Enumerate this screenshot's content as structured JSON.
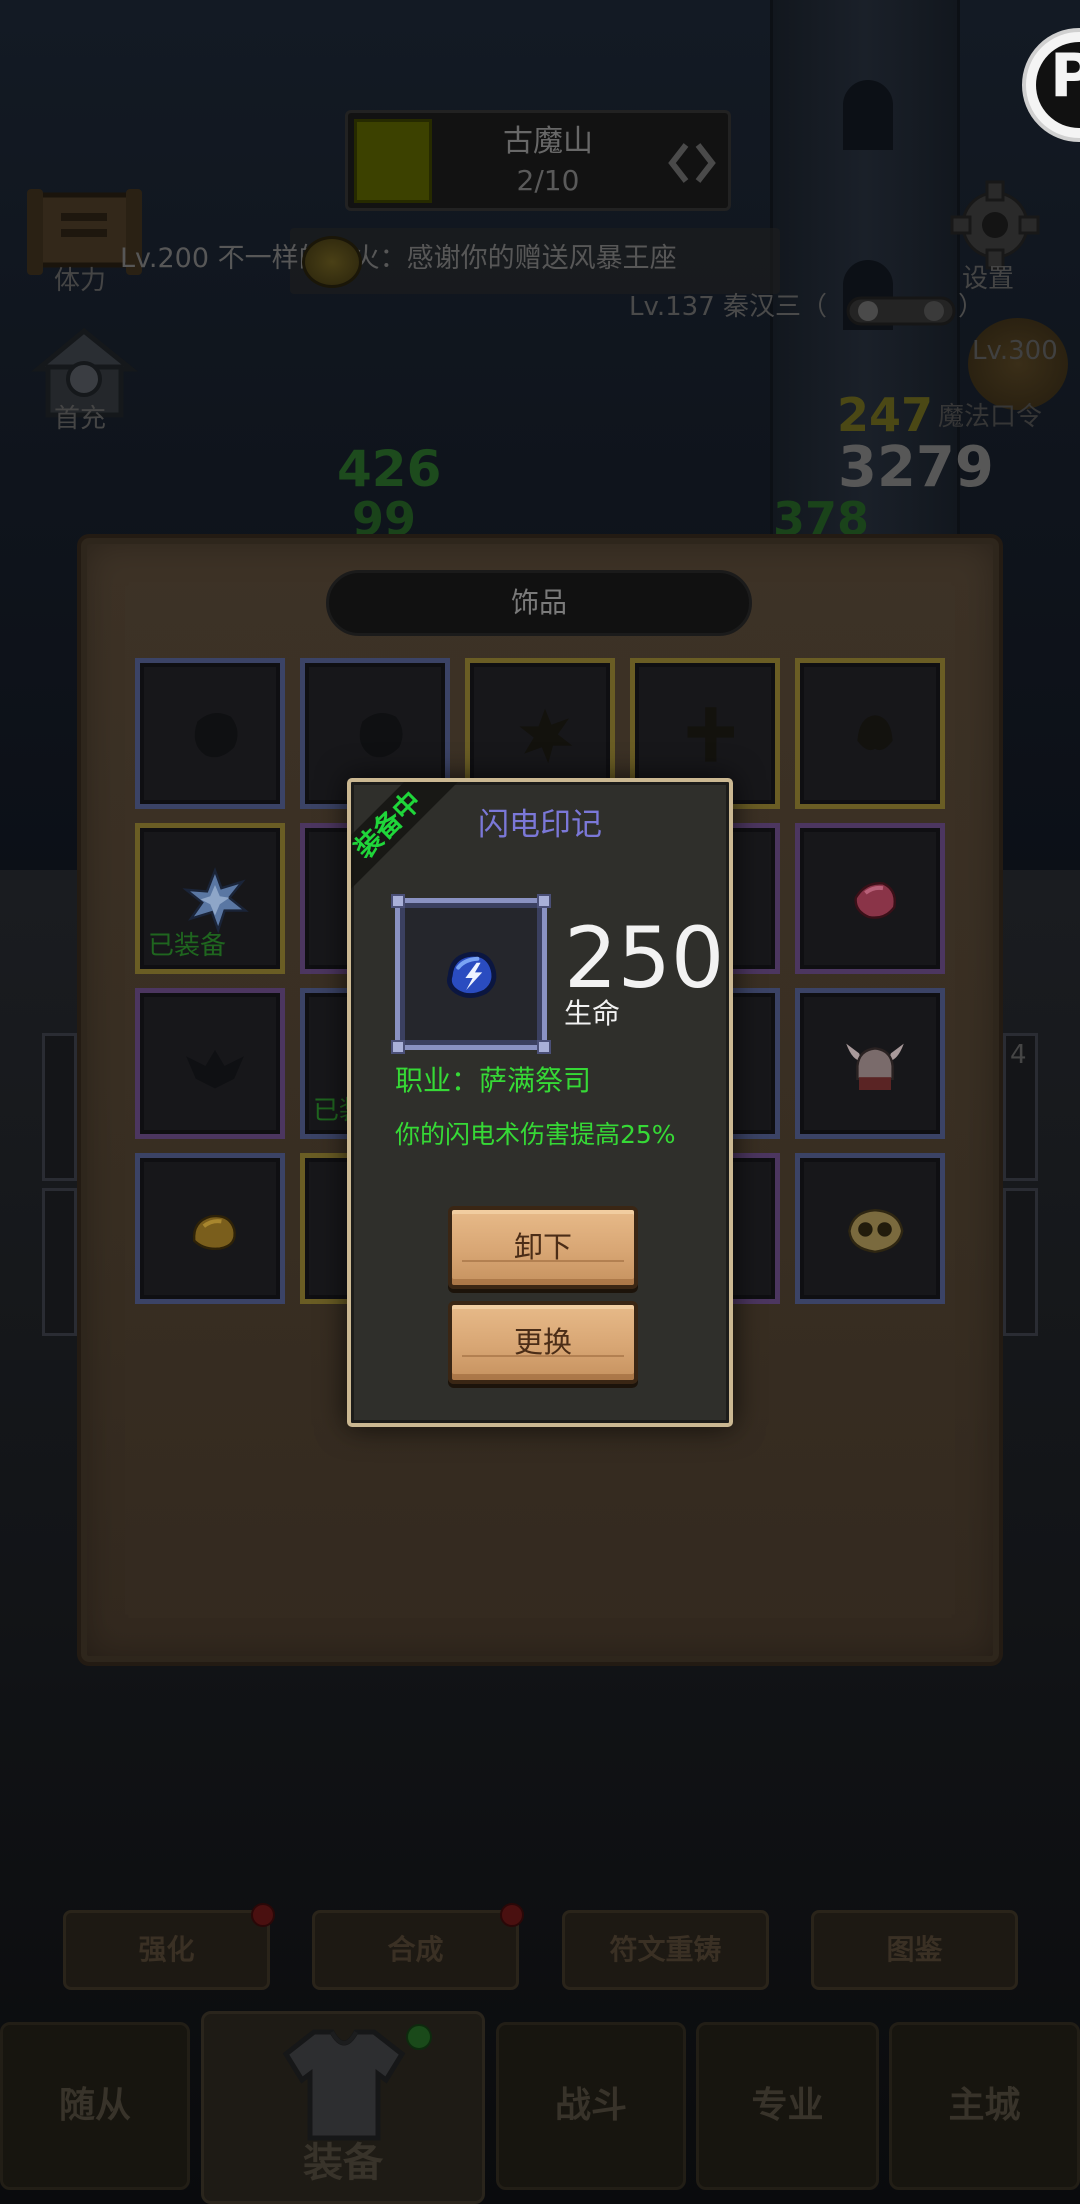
{
  "logo": {
    "letter": "P"
  },
  "stage": {
    "name": "古魔山",
    "progress": "2/10"
  },
  "left_menu": {
    "item1_label": "体力",
    "item2_label": "首充"
  },
  "marquee": {
    "text": "Lv.200 不一样的烟火：感谢你的赠送风暴王座"
  },
  "player": {
    "line": "Lv.137 秦汉三（",
    "close_paren": "）"
  },
  "settings": {
    "label": "设置"
  },
  "enemy": {
    "level": "Lv.300",
    "count": "247",
    "name": "魔法口令",
    "power": "3279"
  },
  "battle_numbers": {
    "value_a": "426",
    "value_b": "99",
    "value_c": "378"
  },
  "side": {
    "count": "4"
  },
  "panel": {
    "title": "饰品",
    "equipped_label": "已装备",
    "rarity_colors": {
      "blue": "#3b4366",
      "gold": "#6a5d24",
      "purple": "#4c3660"
    },
    "slots": [
      {
        "rarity": "blue",
        "icon": "shadow-blob-icon",
        "equipped": false
      },
      {
        "rarity": "blue",
        "icon": "shadow-blob-icon",
        "equipped": false
      },
      {
        "rarity": "gold",
        "icon": "shadow-claw-icon",
        "equipped": false
      },
      {
        "rarity": "gold",
        "icon": "shadow-cross-icon",
        "equipped": false
      },
      {
        "rarity": "gold",
        "icon": "shadow-shell-icon",
        "equipped": false
      },
      {
        "rarity": "gold",
        "icon": "blue-crystal-icon",
        "equipped": true
      },
      {
        "rarity": "purple",
        "icon": null,
        "equipped": false
      },
      {
        "rarity": "blue",
        "icon": null,
        "equipped": false
      },
      {
        "rarity": "purple",
        "icon": null,
        "equipped": false
      },
      {
        "rarity": "purple",
        "icon": "red-gem-icon",
        "equipped": false
      },
      {
        "rarity": "purple",
        "icon": "shadow-wings-icon",
        "equipped": false
      },
      {
        "rarity": "blue",
        "icon": null,
        "equipped": true
      },
      {
        "rarity": "blue",
        "icon": null,
        "equipped": false
      },
      {
        "rarity": "blue",
        "icon": null,
        "equipped": false
      },
      {
        "rarity": "blue",
        "icon": "horned-helmet-icon",
        "equipped": false
      },
      {
        "rarity": "blue",
        "icon": "gold-ore-icon",
        "equipped": false
      },
      {
        "rarity": "gold",
        "icon": null,
        "equipped": false
      },
      {
        "rarity": "blue",
        "icon": null,
        "equipped": false
      },
      {
        "rarity": "purple",
        "icon": null,
        "equipped": false
      },
      {
        "rarity": "blue",
        "icon": "gold-skull-icon",
        "equipped": false
      }
    ]
  },
  "popup": {
    "ribbon": "装备中",
    "item_name": "闪电印记",
    "item_icon": "lightning-gem-icon",
    "stat_value": "250",
    "stat_name": "生命",
    "class_line": "职业：萨满祭司",
    "effect": "你的闪电术伤害提高25%",
    "unequip_label": "卸下",
    "replace_label": "更换",
    "colors": {
      "ribbon": "#1fd63a",
      "title": "#7b78d8",
      "stat_text": "#36d936",
      "frame": "#cbb892"
    }
  },
  "actions": {
    "items": [
      {
        "label": "强化",
        "badge": true
      },
      {
        "label": "合成",
        "badge": true
      },
      {
        "label": "符文重铸",
        "badge": false
      },
      {
        "label": "图鉴",
        "badge": false
      }
    ]
  },
  "nav": {
    "items": [
      {
        "label": "随从"
      },
      {
        "label": "装备",
        "selected": true
      },
      {
        "label": "战斗"
      },
      {
        "label": "专业"
      },
      {
        "label": "主城"
      }
    ]
  }
}
